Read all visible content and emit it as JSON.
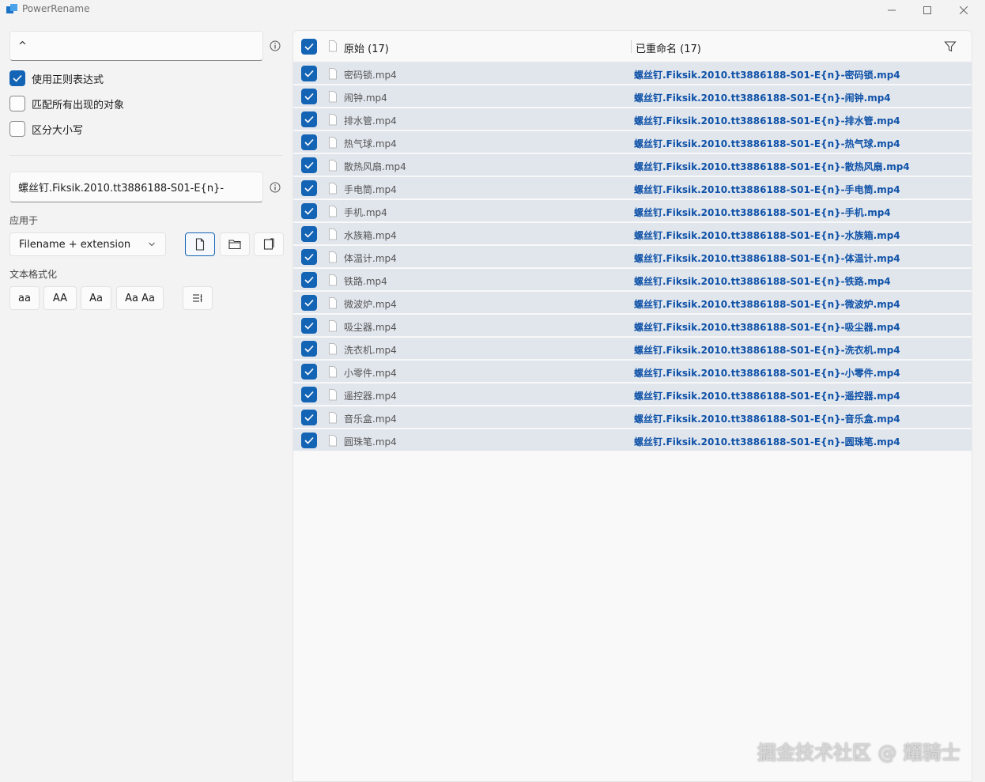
{
  "window": {
    "title": "PowerRename"
  },
  "search": {
    "value": "^"
  },
  "options": {
    "regex_label": "使用正则表达式",
    "regex_checked": true,
    "match_all_label": "匹配所有出现的对象",
    "match_all_checked": false,
    "case_label": "区分大小写",
    "case_checked": false
  },
  "replace": {
    "value": "螺丝钉.Fiksik.2010.tt3886188-S01-E{n}-"
  },
  "apply_to": {
    "label": "应用于",
    "selected": "Filename + extension",
    "buttons": [
      "file-icon",
      "folder-icon",
      "subfolder-icon"
    ]
  },
  "text_format": {
    "label": "文本格式化",
    "buttons": [
      "aa",
      "AA",
      "Aa",
      "Aa Aa"
    ]
  },
  "list": {
    "header_original": "原始 (17)",
    "header_renamed": "已重命名 (17)",
    "rows": [
      {
        "original": "密码锁.mp4",
        "renamed": "螺丝钉.Fiksik.2010.tt3886188-S01-E{n}-密码锁.mp4"
      },
      {
        "original": "闹钟.mp4",
        "renamed": "螺丝钉.Fiksik.2010.tt3886188-S01-E{n}-闹钟.mp4"
      },
      {
        "original": "排水管.mp4",
        "renamed": "螺丝钉.Fiksik.2010.tt3886188-S01-E{n}-排水管.mp4"
      },
      {
        "original": "热气球.mp4",
        "renamed": "螺丝钉.Fiksik.2010.tt3886188-S01-E{n}-热气球.mp4"
      },
      {
        "original": "散热风扇.mp4",
        "renamed": "螺丝钉.Fiksik.2010.tt3886188-S01-E{n}-散热风扇.mp4"
      },
      {
        "original": "手电筒.mp4",
        "renamed": "螺丝钉.Fiksik.2010.tt3886188-S01-E{n}-手电筒.mp4"
      },
      {
        "original": "手机.mp4",
        "renamed": "螺丝钉.Fiksik.2010.tt3886188-S01-E{n}-手机.mp4"
      },
      {
        "original": "水族箱.mp4",
        "renamed": "螺丝钉.Fiksik.2010.tt3886188-S01-E{n}-水族箱.mp4"
      },
      {
        "original": "体温计.mp4",
        "renamed": "螺丝钉.Fiksik.2010.tt3886188-S01-E{n}-体温计.mp4"
      },
      {
        "original": "铁路.mp4",
        "renamed": "螺丝钉.Fiksik.2010.tt3886188-S01-E{n}-铁路.mp4"
      },
      {
        "original": "微波炉.mp4",
        "renamed": "螺丝钉.Fiksik.2010.tt3886188-S01-E{n}-微波炉.mp4"
      },
      {
        "original": "吸尘器.mp4",
        "renamed": "螺丝钉.Fiksik.2010.tt3886188-S01-E{n}-吸尘器.mp4"
      },
      {
        "original": "洗衣机.mp4",
        "renamed": "螺丝钉.Fiksik.2010.tt3886188-S01-E{n}-洗衣机.mp4"
      },
      {
        "original": "小零件.mp4",
        "renamed": "螺丝钉.Fiksik.2010.tt3886188-S01-E{n}-小零件.mp4"
      },
      {
        "original": "遥控器.mp4",
        "renamed": "螺丝钉.Fiksik.2010.tt3886188-S01-E{n}-遥控器.mp4"
      },
      {
        "original": "音乐盒.mp4",
        "renamed": "螺丝钉.Fiksik.2010.tt3886188-S01-E{n}-音乐盒.mp4"
      },
      {
        "original": "圆珠笔.mp4",
        "renamed": "螺丝钉.Fiksik.2010.tt3886188-S01-E{n}-圆珠笔.mp4"
      }
    ]
  },
  "watermark": "掘金技术社区 @ 耀骑士",
  "colors": {
    "accent": "#1464b5",
    "row_bg": "#e1e6ed",
    "renamed_text": "#0f52a8"
  }
}
